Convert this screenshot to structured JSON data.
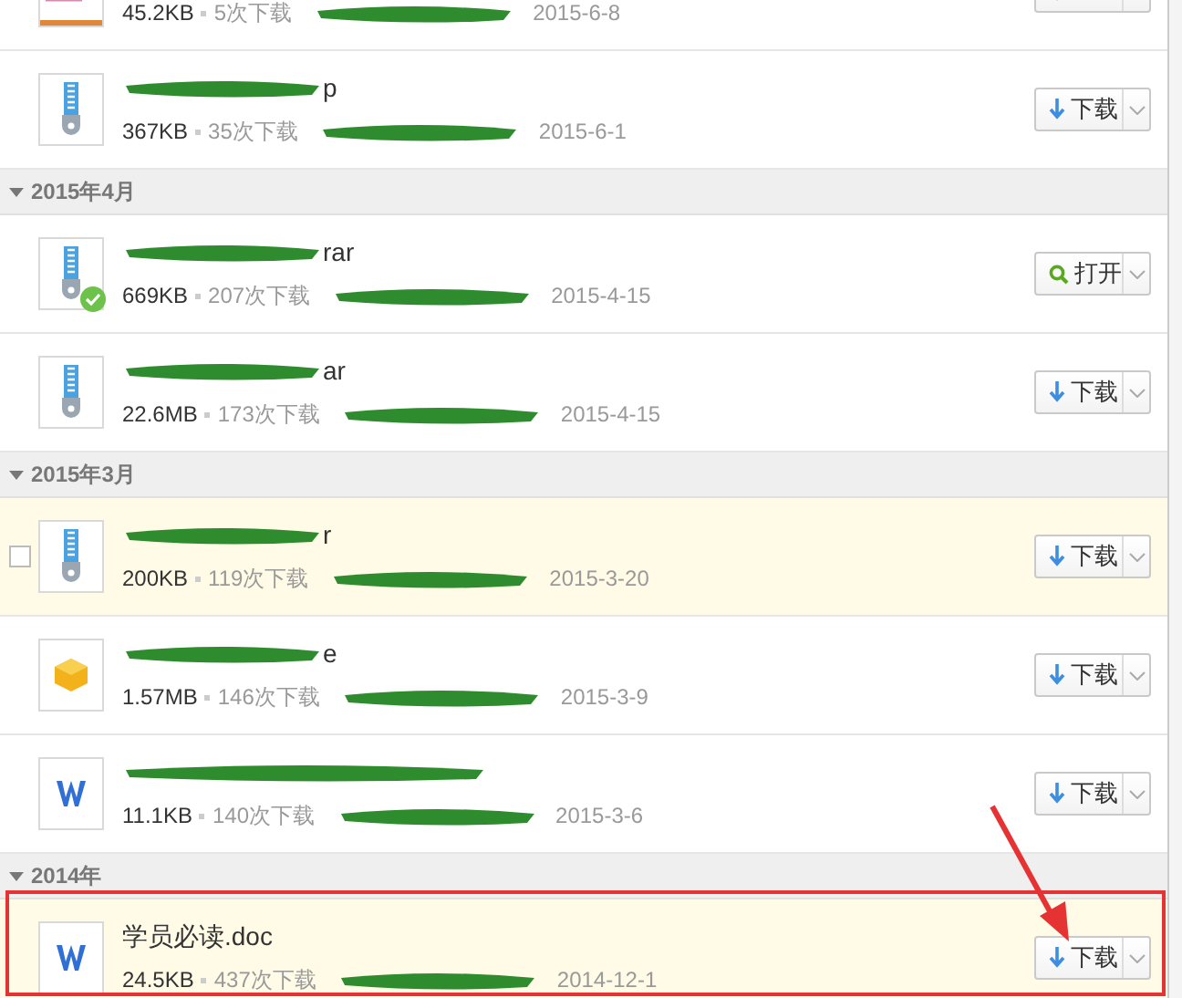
{
  "sections": [
    {
      "items": [
        {
          "kind": "document",
          "size": "45.2KB",
          "downloads": "5次下载",
          "date": "2015-6-8",
          "action": {
            "kind": "download"
          },
          "highlighted": false,
          "hover": false,
          "opened": false
        }
      ]
    },
    {
      "items": [
        {
          "kind": "archive",
          "name_tail": "p",
          "size": "367KB",
          "downloads": "35次下载",
          "date": "2015-6-1",
          "action": {
            "kind": "download",
            "label": "下载"
          },
          "highlighted": false,
          "hover": false,
          "opened": false
        }
      ]
    },
    {
      "header": "2015年4月",
      "items": [
        {
          "kind": "archive",
          "name_tail": "rar",
          "size": "669KB",
          "downloads": "207次下载",
          "date": "2015-4-15",
          "action": {
            "kind": "open",
            "label": "打开"
          },
          "highlighted": false,
          "hover": false,
          "opened": true
        },
        {
          "kind": "archive",
          "name_tail": "ar",
          "size": "22.6MB",
          "downloads": "173次下载",
          "date": "2015-4-15",
          "action": {
            "kind": "download",
            "label": "下载"
          },
          "highlighted": false,
          "hover": false,
          "opened": false
        }
      ]
    },
    {
      "header": "2015年3月",
      "items": [
        {
          "kind": "archive",
          "name_tail": "r",
          "size": "200KB",
          "downloads": "119次下载",
          "date": "2015-3-20",
          "action": {
            "kind": "download",
            "label": "下载"
          },
          "highlighted": true,
          "hover": true,
          "opened": false
        },
        {
          "kind": "program",
          "name_tail": "e",
          "size": "1.57MB",
          "downloads": "146次下载",
          "date": "2015-3-9",
          "action": {
            "kind": "download",
            "label": "下载"
          },
          "highlighted": false,
          "hover": false,
          "opened": false
        },
        {
          "kind": "word",
          "size": "11.1KB",
          "downloads": "140次下载",
          "date": "2015-3-6",
          "action": {
            "kind": "download",
            "label": "下载"
          },
          "highlighted": false,
          "hover": false,
          "opened": false
        }
      ]
    },
    {
      "header": "2014年",
      "items": [
        {
          "kind": "word",
          "name": "学员必读.doc",
          "size": "24.5KB",
          "downloads": "437次下载",
          "date": "2014-12-1",
          "action": {
            "kind": "download",
            "label": "下载"
          },
          "highlighted": true,
          "hover": false,
          "opened": false
        }
      ]
    }
  ]
}
